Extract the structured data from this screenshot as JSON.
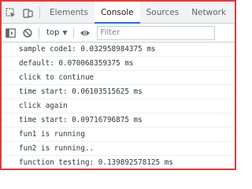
{
  "devtools": {
    "tabs": [
      {
        "label": "Elements"
      },
      {
        "label": "Console"
      },
      {
        "label": "Sources"
      },
      {
        "label": "Network"
      }
    ],
    "active_tab": "Console",
    "toolbar": {
      "context": "top",
      "filter_placeholder": "Filter"
    }
  },
  "console": {
    "messages": [
      {
        "text": "sample code1: 0.032958984375 ms"
      },
      {
        "text": "default: 0.070068359375 ms"
      },
      {
        "text": "click to continue"
      },
      {
        "text": "time start: 0.06103515625 ms"
      },
      {
        "text": "click again"
      },
      {
        "text": "time start: 0.09716796875 ms"
      },
      {
        "text": "fun1 is running"
      },
      {
        "text": "fun2 is running.."
      },
      {
        "text": "function testing: 0.139892578125 ms"
      }
    ]
  },
  "icons": {
    "inspect": "inspect-element-icon",
    "device": "device-toolbar-icon",
    "sidebar": "console-sidebar-icon",
    "clear": "clear-console-icon",
    "eye": "live-expression-icon"
  },
  "colors": {
    "frame_border": "#e03a3e",
    "active_tab_underline": "#1a73e8",
    "tabbar_bg": "#f1f3f4"
  }
}
